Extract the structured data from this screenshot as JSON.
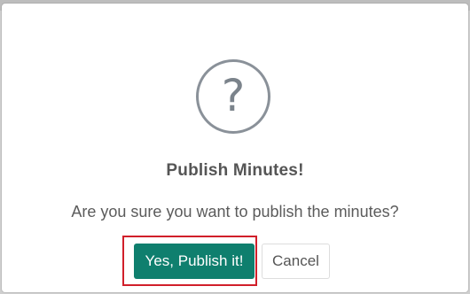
{
  "dialog": {
    "icon": "question-circle-icon",
    "icon_glyph": "?",
    "title": "Publish Minutes!",
    "message": "Are you sure you want to publish the minutes?",
    "confirm_label": "Yes, Publish it!",
    "cancel_label": "Cancel"
  },
  "colors": {
    "confirm_bg": "#0f7f6e",
    "highlight_border": "#d11f2a",
    "icon_color": "#8a9199"
  }
}
